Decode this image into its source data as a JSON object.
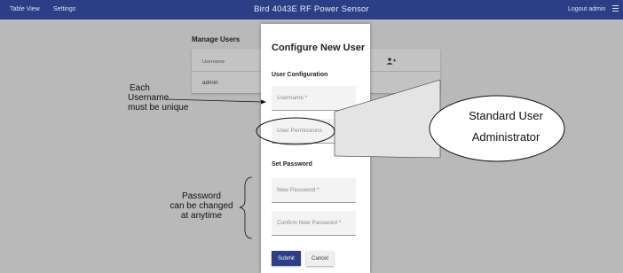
{
  "topbar": {
    "nav_table_view": "Table View",
    "nav_settings": "Settings",
    "title": "Bird 4043E RF Power Sensor",
    "logout": "Logout admin"
  },
  "page": {
    "manage_title": "Manage Users",
    "table_header_username": "Username",
    "row_username": "admin"
  },
  "modal": {
    "title": "Configure New User",
    "section_user_config": "User Configuration",
    "username_placeholder": "Username *",
    "permissions_placeholder": "User Permissions",
    "section_password": "Set Password",
    "new_password_placeholder": "New Password *",
    "confirm_password_placeholder": "Confirm New Password *",
    "submit_label": "Submit",
    "cancel_label": "Cancel"
  },
  "annotations": {
    "unique_line1": "Each",
    "unique_line2": "Username",
    "unique_line3": "must be unique",
    "password_line1": "Password",
    "password_line2": "can be changed",
    "password_line3": "at anytime",
    "callout_line1": "Standard User",
    "callout_line2": "Administrator"
  },
  "icons": {
    "add_user": "add-user-icon",
    "menu": "hamburger-menu-icon",
    "dropdown": "caret-down-icon"
  },
  "colors": {
    "topbar": "#2c3e85",
    "backdrop": "#b9b9b9",
    "submit": "#2c3e85"
  }
}
